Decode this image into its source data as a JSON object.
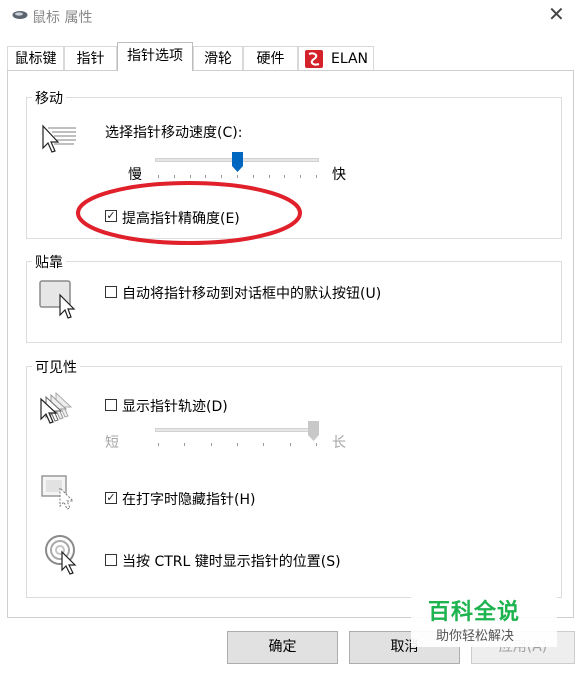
{
  "window": {
    "title": "鼠标 属性",
    "close_symbol": "✕"
  },
  "tabs": [
    {
      "label": "鼠标键"
    },
    {
      "label": "指针"
    },
    {
      "label": "指针选项"
    },
    {
      "label": "滑轮"
    },
    {
      "label": "硬件"
    },
    {
      "label": "ELAN"
    }
  ],
  "motion": {
    "group_label": "移动",
    "speed_label": "选择指针移动速度(C):",
    "slow_label": "慢",
    "fast_label": "快",
    "speed_fraction": 0.5,
    "precision_label": "提高指针精确度(E)",
    "precision_checked": true
  },
  "snap": {
    "group_label": "贴靠",
    "snap_label": "自动将指针移动到对话框中的默认按钮(U)",
    "snap_checked": false
  },
  "visibility": {
    "group_label": "可见性",
    "trails_label": "显示指针轨迹(D)",
    "trails_checked": false,
    "short_label": "短",
    "long_label": "长",
    "trails_fraction": 1.0,
    "hide_label": "在打字时隐藏指针(H)",
    "hide_checked": true,
    "ctrl_label": "当按 CTRL 键时显示指针的位置(S)",
    "ctrl_checked": false
  },
  "buttons": {
    "ok": "确定",
    "cancel": "取消",
    "apply": "应用(A)"
  },
  "watermark": {
    "title": "百科全说",
    "subtitle": "助你轻松解决"
  },
  "colors": {
    "accent": "#0067c0",
    "annotation": "#e0202a",
    "watermark": "#1db34e"
  },
  "icons": {
    "title": "mouse-icon",
    "elan": "elan-logo-icon",
    "motion": "pointer-speed-icon",
    "snap": "snap-to-icon",
    "trails": "pointer-trails-icon",
    "hide": "hide-pointer-icon",
    "ctrl": "pointer-location-icon"
  }
}
